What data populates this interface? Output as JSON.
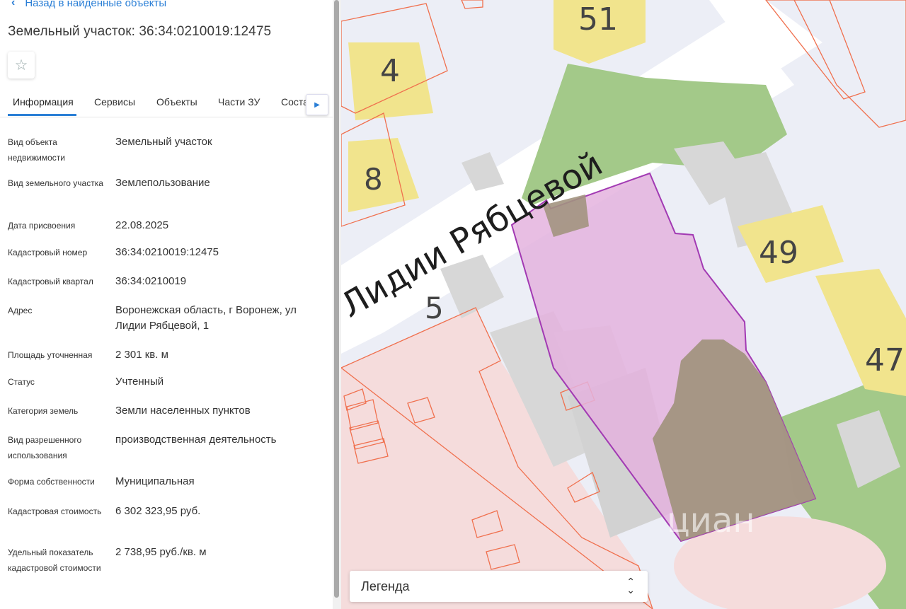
{
  "header": {
    "back_label": "Назад в найденные объекты",
    "title": "Земельный участок: 36:34:0210019:12475"
  },
  "icons": {
    "back": "chevron-left-icon",
    "favorite": "star-outline-icon",
    "tabs_next": "chevron-right-icon",
    "legend_toggle": "sort-arrows-icon"
  },
  "tabs": [
    {
      "label": "Информация",
      "active": true
    },
    {
      "label": "Сервисы"
    },
    {
      "label": "Объекты"
    },
    {
      "label": "Части ЗУ"
    },
    {
      "label": "Состав"
    }
  ],
  "info": [
    {
      "label": "Вид объекта недвижимости",
      "value": "Земельный участок"
    },
    {
      "label": "Вид земельного участка",
      "value": "Землепользование"
    },
    {
      "label": "Дата присвоения",
      "value": "22.08.2025"
    },
    {
      "label": "Кадастровый номер",
      "value": "36:34:0210019:12475"
    },
    {
      "label": "Кадастровый квартал",
      "value": "36:34:0210019"
    },
    {
      "label": "Адрес",
      "value": "Воронежская область, г Воронеж, ул Лидии Рябцевой, 1"
    },
    {
      "label": "Площадь уточненная",
      "value": "2 301 кв. м"
    },
    {
      "label": "Статус",
      "value": "Учтенный"
    },
    {
      "label": "Категория земель",
      "value": "Земли населенных пунктов"
    },
    {
      "label": "Вид разрешенного использования",
      "value": "производственная деятельность"
    },
    {
      "label": "Форма собственности",
      "value": "Муниципальная"
    },
    {
      "label": "Кадастровая стоимость",
      "value": "6 302 323,95 руб."
    },
    {
      "label": "Удельный показатель кадастровой стоимости",
      "value": "2 738,95 руб./кв. м"
    }
  ],
  "map": {
    "street_name": "Лидии Рябцевой",
    "house_numbers": [
      "51",
      "4",
      "8",
      "5",
      "49",
      "47"
    ],
    "watermark": "циан"
  },
  "legend": {
    "label": "Легенда"
  },
  "colors": {
    "accent": "#2b7fd6",
    "parcel_fill": "#e4b3de",
    "parcel_stroke": "#a23ab3",
    "cadastre_stroke": "#f0704e",
    "building": "#f1e48d",
    "green": "#a3c989"
  }
}
